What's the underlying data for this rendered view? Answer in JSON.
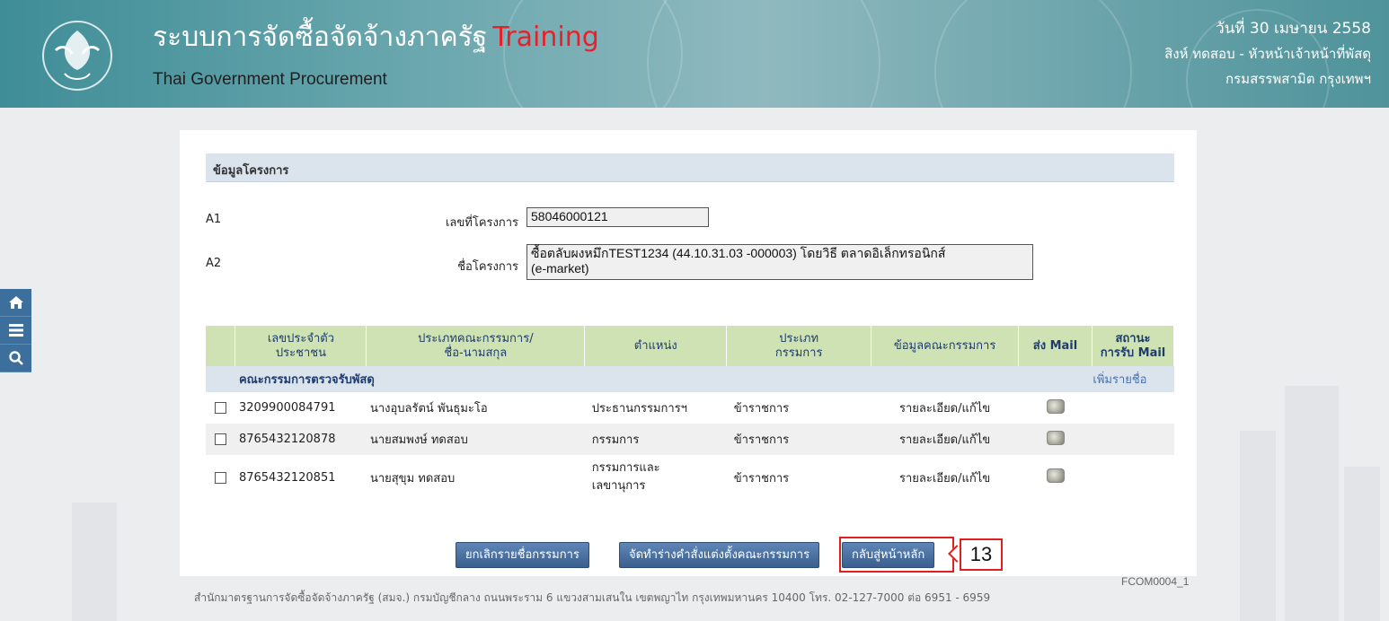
{
  "header": {
    "title_th": "ระบบการจัดซื้อจัดจ้างภาครัฐ",
    "title_badge": "Training",
    "title_en": "Thai Government Procurement",
    "date": "วันที่ 30 เมษายน 2558",
    "user": "สิงห์ ทดสอบ - หัวหน้าเจ้าหน้าที่พัสดุ",
    "department": "กรมสรรพสามิต กรุงเทพฯ"
  },
  "sidenav": {
    "items": [
      {
        "icon": "home-icon"
      },
      {
        "icon": "menu-icon"
      },
      {
        "icon": "search-icon"
      }
    ]
  },
  "project": {
    "section_title": "ข้อมูลโครงการ",
    "row1": {
      "code": "A1",
      "label": "เลขที่โครงการ",
      "value": "58046000121"
    },
    "row2": {
      "code": "A2",
      "label": "ชื่อโครงการ",
      "value_line1": "ซื้อตลับผงหมึกTEST1234 (44.10.31.03 -000003) โดยวิธี ตลาดอิเล็กทรอนิกส์",
      "value_line2": "(e-market)"
    }
  },
  "table": {
    "headers": {
      "id_line1": "เลขประจำตัว",
      "id_line2": "ประชาชน",
      "type_line1": "ประเภทคณะกรรมการ/",
      "type_line2": "ชื่อ-นามสกุล",
      "position": "ตำแหน่ง",
      "member_type_line1": "ประเภท",
      "member_type_line2": "กรรมการ",
      "info": "ข้อมูลคณะกรรมการ",
      "send_mail": "ส่ง Mail",
      "status_line1": "สถานะ",
      "status_line2": "การรับ Mail"
    },
    "group_title": "คณะกรรมการตรวจรับพัสดุ",
    "add_name": "เพิ่มรายชื่อ",
    "rows": [
      {
        "id": "3209900084791",
        "name": "นางอุบลรัตน์ พันธุมะโอ",
        "position": "ประธานกรรมการฯ",
        "position2": "",
        "type": "ข้าราชการ",
        "link": "รายละเอียด/แก้ไข",
        "mail_icon": "mail-icon"
      },
      {
        "id": "8765432120878",
        "name": "นายสมพงษ์ ทดสอบ",
        "position": "กรรมการ",
        "position2": "",
        "type": "ข้าราชการ",
        "link": "รายละเอียด/แก้ไข",
        "mail_icon": "mail-icon"
      },
      {
        "id": "8765432120851",
        "name": "นายสุขุม ทดสอบ",
        "position": "กรรมการและ",
        "position2": "เลขานุการ",
        "type": "ข้าราชการ",
        "link": "รายละเอียด/แก้ไข",
        "mail_icon": "mail-icon"
      }
    ]
  },
  "buttons": {
    "cancel": "ยกเลิกรายชื่อกรรมการ",
    "draft": "จัดทำร่างคำสั่งแต่งตั้งคณะกรรมการ",
    "back": "กลับสู่หน้าหลัก"
  },
  "callout_number": "13",
  "footer": "สำนักมาตรฐานการจัดซื้อจัดจ้างภาครัฐ (สมจ.) กรมบัญชีกลาง ถนนพระราม 6 แขวงสามเสนใน เขตพญาไท กรุงเทพมหานคร 10400 โทร. 02-127-7000 ต่อ 6951 - 6959",
  "page_code": "FCOM0004_1",
  "colors": {
    "header_teal": "#5f9fa6",
    "training_red": "#e8202a",
    "table_header_green": "#cfe2b3",
    "section_blue": "#dbe3ed",
    "button_blue": "#4a6f9f",
    "link_blue": "#4a72a8",
    "callout_red": "#e02020"
  }
}
